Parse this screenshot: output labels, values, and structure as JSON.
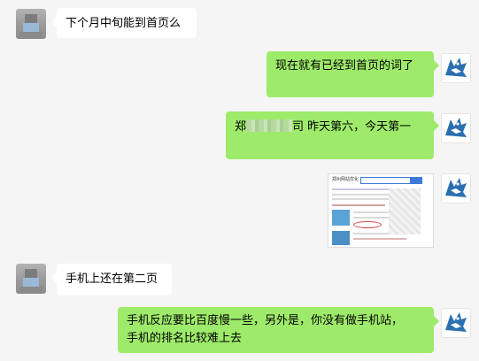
{
  "messages": [
    {
      "side": "left",
      "text": "下个月中旬能到首页么"
    },
    {
      "side": "right",
      "text": "现在就有已经到首页的词了"
    },
    {
      "side": "right",
      "text_prefix": "郑",
      "text_suffix": "司 昨天第六，今天第一"
    },
    {
      "side": "right",
      "type": "image",
      "image_title": "郑州网站优化"
    },
    {
      "side": "left",
      "text": "手机上还在第二页"
    },
    {
      "side": "right",
      "lines": [
        "手机反应要比百度慢一些，另外是，你没有做手机站，",
        "手机的排名比较难上去"
      ]
    }
  ],
  "colors": {
    "background": "#f5f5f5",
    "bubble_self": "#9eea6a",
    "bubble_other": "#ffffff"
  },
  "icons": {
    "self_avatar": "wolf-logo-icon",
    "other_avatar": "pixelated-avatar-icon"
  }
}
